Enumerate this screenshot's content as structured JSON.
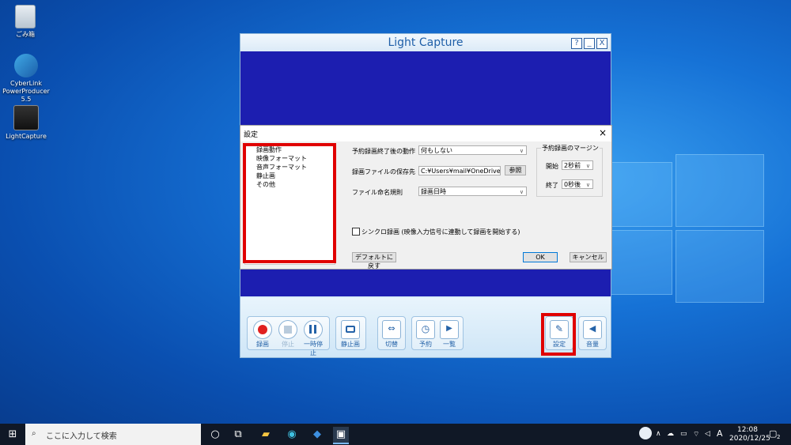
{
  "desktop": {
    "icons": [
      {
        "label": "ごみ箱"
      },
      {
        "label": "CyberLink PowerProducer 5.5"
      },
      {
        "label": "LightCapture"
      }
    ]
  },
  "app": {
    "title": "Light Capture",
    "title_buttons": {
      "help": "?",
      "minimize": "_",
      "close": "X"
    },
    "controls": {
      "record": "録画",
      "stop": "停止",
      "pause": "一時停止",
      "still": "静止画",
      "switch": "切替",
      "schedule": "予約",
      "list": "一覧",
      "settings": "設定",
      "volume": "音量"
    }
  },
  "settings": {
    "title": "設定",
    "close": "×",
    "tree": [
      "録画動作",
      "映像フォーマット",
      "音声フォーマット",
      "静止画",
      "その他"
    ],
    "after_schedule_label": "予約録画終了後の動作",
    "after_schedule_value": "何もしない",
    "save_path_label": "録画ファイルの保存先",
    "save_path_value": "C:¥Users¥mail¥OneDrive¥ドキ",
    "browse": "参照",
    "naming_label": "ファイル命名規則",
    "naming_value": "録画日時",
    "margin_group": "予約録画のマージン",
    "start_label": "開始",
    "start_value": "2秒前",
    "end_label": "終了",
    "end_value": "0秒後",
    "sync_checkbox": "シンクロ録画 (映像入力信号に連動して録画を開始する)",
    "default_button": "デフォルトに戻す",
    "ok": "OK",
    "cancel": "キャンセル"
  },
  "taskbar": {
    "search_placeholder": "ここに入力して検索",
    "ime": "A",
    "time": "12:08",
    "date": "2020/12/25",
    "notifications": "2"
  }
}
